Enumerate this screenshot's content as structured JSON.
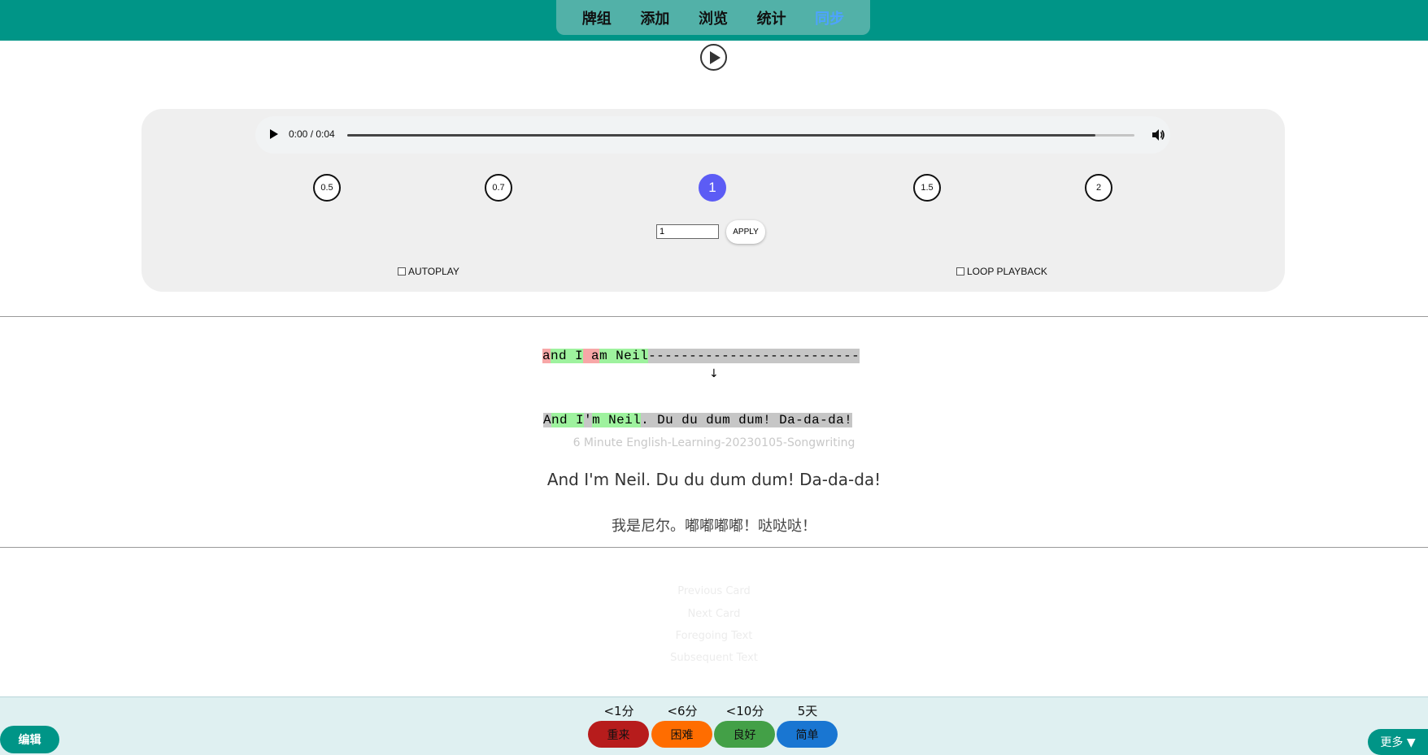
{
  "topnav": {
    "items": [
      {
        "label": "牌组"
      },
      {
        "label": "添加"
      },
      {
        "label": "浏览"
      },
      {
        "label": "统计"
      },
      {
        "label": "同步"
      }
    ],
    "active_index": 4
  },
  "player": {
    "time": "0:00 / 0:04",
    "progress": 0.95
  },
  "speeds": [
    "0.5",
    "0.7",
    "1",
    "1.5",
    "2"
  ],
  "active_speed": "1",
  "rate": {
    "value": "1",
    "apply_label": "APPLY"
  },
  "options": {
    "autoplay_label": "AUTOPLAY",
    "loop_label": "LOOP PLAYBACK"
  },
  "comparison": {
    "line1": [
      {
        "text": "a",
        "hl": "red"
      },
      {
        "text": "nd I",
        "hl": "green"
      },
      {
        "text": " a",
        "hl": "red"
      },
      {
        "text": "m Neil",
        "hl": "green"
      },
      {
        "text": "--------------------------",
        "hl": "gray"
      }
    ],
    "arrow": "↓",
    "line2": [
      {
        "text": "A",
        "hl": "gray"
      },
      {
        "text": "nd I",
        "hl": "green"
      },
      {
        "text": "'",
        "hl": "gray"
      },
      {
        "text": "m Neil",
        "hl": "green"
      },
      {
        "text": ". Du du dum dum! Da-da-da!",
        "hl": "gray"
      }
    ]
  },
  "source": "6 Minute English-Learning-20230105-Songwriting",
  "sentence_en": "And I'm Neil. Du du dum dum! Da-da-da!",
  "sentence_zh": "我是尼尔。嘟嘟嘟嘟！哒哒哒！",
  "card_links": {
    "previous": "Previous Card",
    "next": "Next Card",
    "foregoing": "Foregoing Text",
    "subsequent": "Subsequent Text"
  },
  "answers": [
    {
      "interval": "<1分",
      "label": "重来",
      "color": "#b71c1c"
    },
    {
      "interval": "<6分",
      "label": "困难",
      "color": "#ff6d00"
    },
    {
      "interval": "<10分",
      "label": "良好",
      "color": "#43a047"
    },
    {
      "interval": "5天",
      "label": "简单",
      "color": "#1976d2"
    }
  ],
  "edit_label": "编辑",
  "more_label": "更多 ▼",
  "colors": {
    "topbar": "#009587",
    "active_nav": "#4ea3ff",
    "speed_active": "#5c5cf5"
  }
}
